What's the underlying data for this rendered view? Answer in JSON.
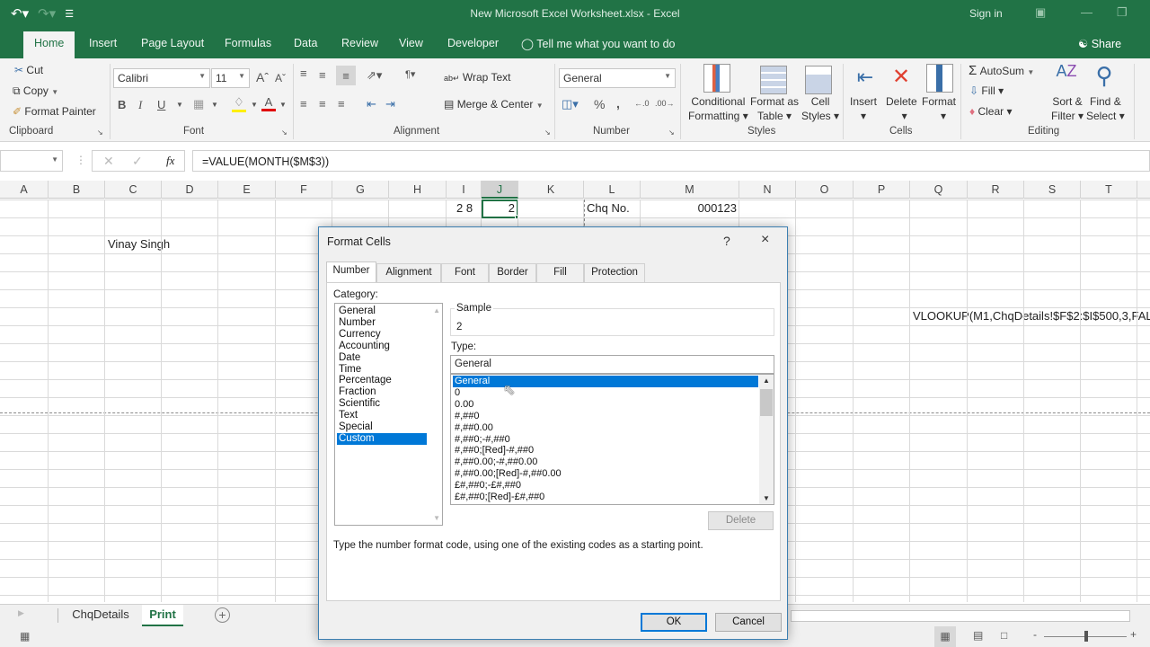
{
  "window": {
    "title": "New Microsoft Excel Worksheet.xlsx  -  Excel",
    "sign_in": "Sign in"
  },
  "ribbon_tabs": [
    "Home",
    "Insert",
    "Page Layout",
    "Formulas",
    "Data",
    "Review",
    "View",
    "Developer"
  ],
  "active_tab": "Home",
  "tell_me": "Tell me what you want to do",
  "share": "Share",
  "clipboard": {
    "cut": "Cut",
    "copy": "Copy",
    "format_painter": "Format Painter",
    "label": "Clipboard"
  },
  "font": {
    "name": "Calibri",
    "size": "11",
    "bold": "B",
    "italic": "I",
    "underline": "U",
    "label": "Font"
  },
  "alignment": {
    "wrap_text": "Wrap Text",
    "merge_center": "Merge & Center",
    "label": "Alignment"
  },
  "number": {
    "format": "General",
    "percent": "%",
    "comma": ",",
    "label": "Number"
  },
  "styles": {
    "conditional": "Conditional",
    "conditional2": "Formatting",
    "format_as": "Format as",
    "format_as2": "Table",
    "cell": "Cell",
    "cell2": "Styles",
    "label": "Styles"
  },
  "cells": {
    "insert": "Insert",
    "delete": "Delete",
    "format": "Format",
    "label": "Cells"
  },
  "editing": {
    "autosum": "AutoSum",
    "fill": "Fill",
    "clear": "Clear",
    "sort": "Sort &",
    "sort2": "Filter",
    "find": "Find &",
    "find2": "Select",
    "label": "Editing"
  },
  "formula_bar": {
    "name_box": "",
    "formula": "=VALUE(MONTH($M$3))",
    "fx": "fx"
  },
  "columns": [
    "A",
    "B",
    "C",
    "D",
    "E",
    "F",
    "G",
    "H",
    "I",
    "J",
    "K",
    "L",
    "M",
    "N",
    "O",
    "P",
    "Q",
    "R",
    "S",
    "T"
  ],
  "selected_column": "J",
  "cells_data": {
    "i1": "2 8",
    "j1": "2",
    "l1": "Chq No.",
    "m1": "000123",
    "c3": "Vinay Singh",
    "q7": "VLOOKUP(M1,ChqDetails!$F$2:$I$500,3,FAL"
  },
  "sheets": [
    {
      "name": "ChqDetails",
      "active": false
    },
    {
      "name": "Print",
      "active": true
    }
  ],
  "dialog": {
    "title": "Format Cells",
    "help": "?",
    "close": "×",
    "tabs": [
      "Number",
      "Alignment",
      "Font",
      "Border",
      "Fill",
      "Protection"
    ],
    "active_tab": "Number",
    "category_label": "Category:",
    "categories": [
      "General",
      "Number",
      "Currency",
      "Accounting",
      "Date",
      "Time",
      "Percentage",
      "Fraction",
      "Scientific",
      "Text",
      "Special",
      "Custom"
    ],
    "selected_category": "Custom",
    "sample_label": "Sample",
    "sample_value": "2",
    "type_label": "Type:",
    "type_value": "General",
    "type_list": [
      "General",
      "0",
      "0.00",
      "#,##0",
      "#,##0.00",
      "#,##0;-#,##0",
      "#,##0;[Red]-#,##0",
      "#,##0.00;-#,##0.00",
      "#,##0.00;[Red]-#,##0.00",
      "£#,##0;-£#,##0",
      "£#,##0;[Red]-£#,##0"
    ],
    "selected_type": "General",
    "delete": "Delete",
    "hint": "Type the number format code, using one of the existing codes as a starting point.",
    "ok": "OK",
    "cancel": "Cancel"
  },
  "colors": {
    "excel_green": "#217346",
    "selection_blue": "#0078d7"
  }
}
